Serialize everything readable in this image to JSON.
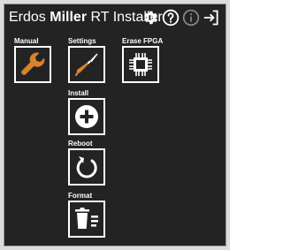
{
  "title": {
    "normal": "Erdos ",
    "bold": "Miller",
    "rest": " RT Installer"
  },
  "header_icons": [
    "gear-icon",
    "help-icon",
    "info-icon",
    "exit-icon"
  ],
  "tiles": {
    "manual": {
      "label": "Manual",
      "icon": "wrench-icon"
    },
    "settings": {
      "label": "Settings",
      "icon": "screwdriver-icon"
    },
    "erase_fpga": {
      "label": "Erase FPGA",
      "icon": "chip-icon"
    },
    "install": {
      "label": "Install",
      "icon": "plus-circle-icon"
    },
    "reboot": {
      "label": "Reboot",
      "icon": "reboot-icon"
    },
    "format": {
      "label": "Format",
      "icon": "trash-list-icon"
    }
  },
  "colors": {
    "background": "#232323",
    "accent": "#d9822b",
    "foreground": "#ffffff"
  }
}
